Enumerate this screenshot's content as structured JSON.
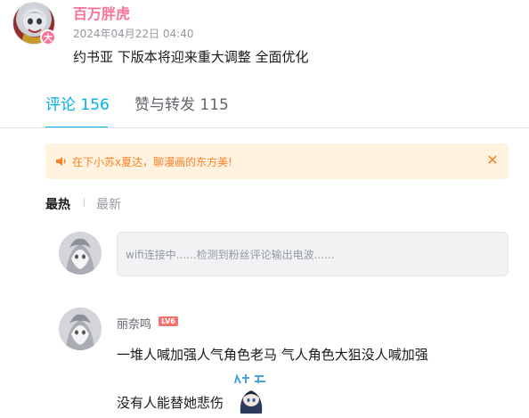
{
  "post": {
    "username": "百万胖虎",
    "badge": "大",
    "date": "2024年04月22日 04:40",
    "text": "约书亚 下版本将迎来重大调整 全面优化"
  },
  "tabs": {
    "comments": "评论 156",
    "likes_shares": "赞与转发 115"
  },
  "notice": {
    "text": "在下小苏x夏达，聊漫画的东方美!",
    "icon": "speaker-icon",
    "close_icon": "close-icon"
  },
  "sort": {
    "hot": "最热",
    "new": "最新"
  },
  "reply": {
    "placeholder": "wifi连接中......检测到粉丝评论输出电波......"
  },
  "comment": {
    "username": "丽奈鸣",
    "level": "LV6",
    "line1": "一堆人喊加强人气角色老马 气人角色大狙没人喊加强",
    "line2": "没有人能替她悲伤"
  },
  "colors": {
    "accent": "#00aeec",
    "username": "#fb7299",
    "notice_bg": "#fff3e0",
    "notice_text": "#ff7f24"
  }
}
